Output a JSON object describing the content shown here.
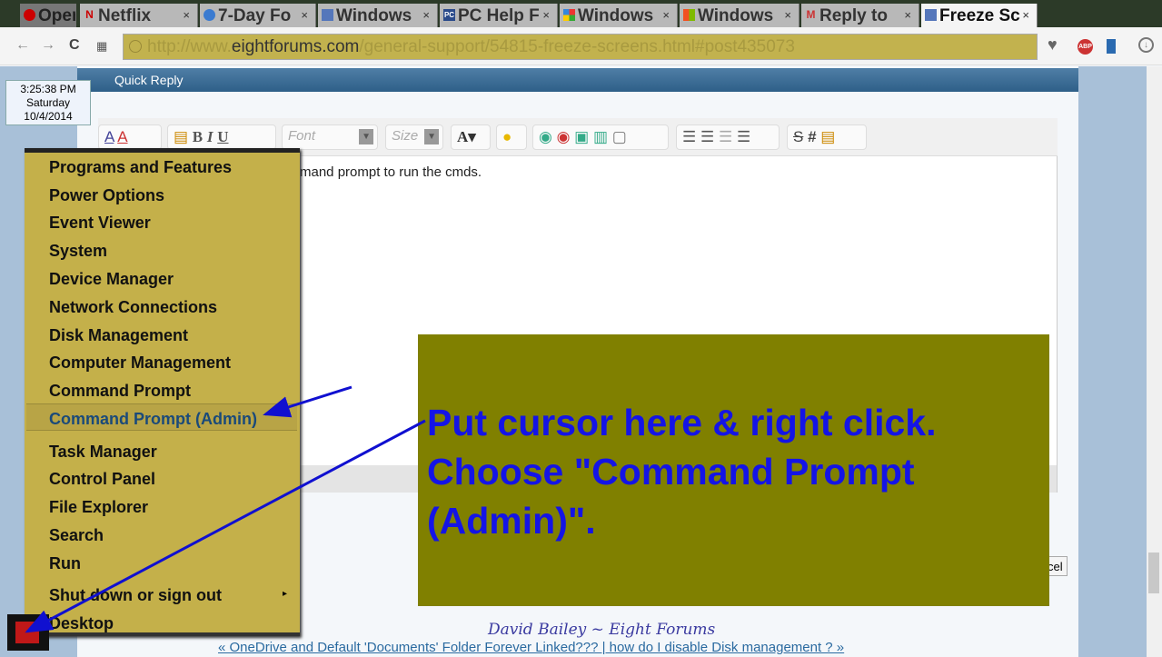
{
  "browser": {
    "tabs": [
      {
        "label": "Opera",
        "icon": "opera-icon"
      },
      {
        "label": "Netflix",
        "icon": "netflix-icon"
      },
      {
        "label": "7-Day Fo",
        "icon": "weather-icon"
      },
      {
        "label": "Windows",
        "icon": "windows-forum-icon"
      },
      {
        "label": "PC Help F",
        "icon": "pc-help-icon"
      },
      {
        "label": "Windows",
        "icon": "windows-forum-icon"
      },
      {
        "label": "Windows",
        "icon": "windows-logo-icon"
      },
      {
        "label": "Reply to",
        "icon": "gmail-icon"
      },
      {
        "label": "Freeze Sc",
        "icon": "eightforums-icon",
        "active": true
      }
    ],
    "url_prefix": "http://www.",
    "url_domain": "eightforums.com",
    "url_path": "/general-support/54815-freeze-screens.html#post435073"
  },
  "clock": {
    "time": "3:25:38 PM",
    "day": "Saturday",
    "date": "10/4/2014"
  },
  "page": {
    "quick_reply": "Quick Reply",
    "toolbar": {
      "font_placeholder": "Font",
      "size_placeholder": "Size"
    },
    "editor_text": "mand prompt to run the cmds.",
    "cancel_label": "cel",
    "signature": "David Bailey ~ Eight Forums",
    "footer_links": "« OneDrive and Default 'Documents' Folder Forever Linked??? | how do I disable Disk management ? »"
  },
  "winx_menu": {
    "items": [
      "Programs and Features",
      "Power Options",
      "Event Viewer",
      "System",
      "Device Manager",
      "Network Connections",
      "Disk Management",
      "Computer Management",
      "Command Prompt",
      "Command Prompt (Admin)",
      "Task Manager",
      "Control Panel",
      "File Explorer",
      "Search",
      "Run",
      "Shut down or sign out",
      "Desktop"
    ],
    "highlighted": "Command Prompt (Admin)",
    "bg_color": "#c4b04a",
    "highlight_text_color": "#1a4a7a"
  },
  "annotation": {
    "line1": "Put cursor here & right click.",
    "line2": "Choose \"Command Prompt",
    "line3": "(Admin)\".",
    "bg_color": "#808000",
    "text_color": "#1414e6"
  }
}
